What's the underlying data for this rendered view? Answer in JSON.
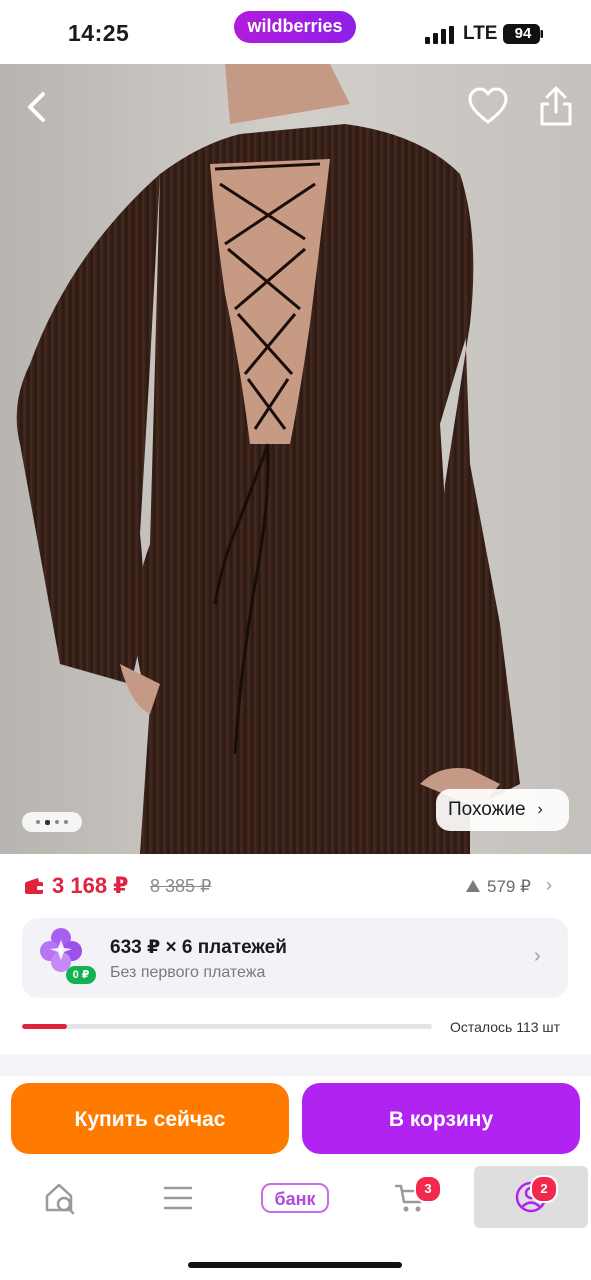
{
  "status_bar": {
    "time": "14:25",
    "brand": "wildberries",
    "network": "LTE",
    "battery": "94"
  },
  "gallery": {
    "similar_label": "Похожие",
    "dots_total": 4,
    "dots_active": 2
  },
  "price": {
    "current": "3 168 ₽",
    "old": "8 385 ₽",
    "drop": "579 ₽"
  },
  "installment": {
    "title": "633 ₽ × 6 платежей",
    "subtitle": "Без первого платежа",
    "badge": "0 ₽"
  },
  "stock": {
    "label": "Осталось 113 шт",
    "fill_fraction": 0.11
  },
  "actions": {
    "buy_now": "Купить сейчас",
    "add_to_cart": "В корзину"
  },
  "nav": {
    "bank_label": "банк",
    "cart_badge": "3",
    "profile_badge": "2"
  },
  "colors": {
    "accent_red": "#e0223f",
    "buy_orange": "#ff7b00",
    "cart_purple": "#b123f0",
    "brand_gradient_start": "#b11cdb"
  },
  "icons": [
    "back-arrow-icon",
    "heart-icon",
    "share-icon",
    "wallet-icon",
    "triangle-up-icon",
    "split-payment-icon",
    "home-search-icon",
    "menu-icon",
    "cart-icon",
    "profile-icon"
  ]
}
